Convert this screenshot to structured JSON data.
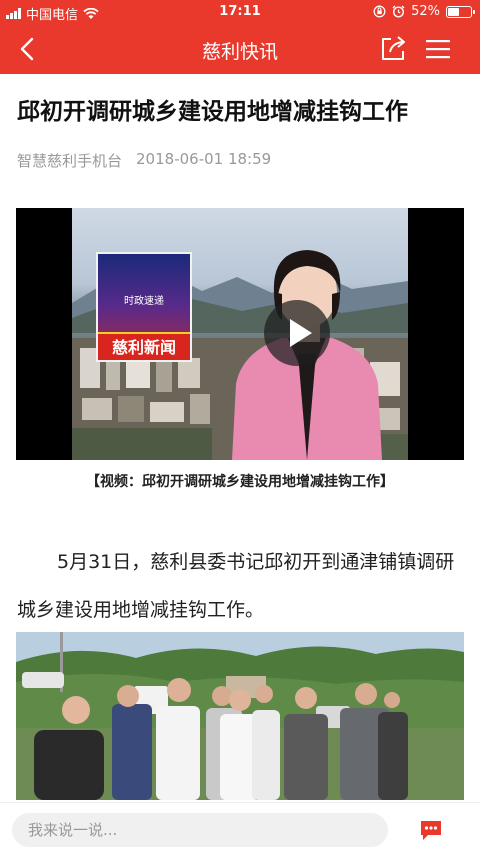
{
  "status_bar": {
    "carrier": "中国电信",
    "time": "17:11",
    "battery_percent": "52%",
    "battery_level": 0.52
  },
  "nav": {
    "title": "慈利快讯",
    "back_icon": "chevron-left-icon",
    "share_icon": "share-icon",
    "menu_icon": "menu-icon"
  },
  "article": {
    "title": "邱初开调研城乡建设用地增减挂钩工作",
    "source": "智慧慈利手机台",
    "datetime": "2018-06-01 18:59",
    "video": {
      "logo_top_text": "时政速递",
      "logo_band_text": "慈利新闻",
      "play_icon": "play-icon"
    },
    "video_caption": "【视频：邱初开调研城乡建设用地增减挂钩工作】",
    "paragraph": "5月31日，慈利县委书记邱初开到通津铺镇调研城乡建设用地增减挂钩工作。"
  },
  "comment_bar": {
    "placeholder": "我来说一说...",
    "comment_icon": "comment-icon"
  },
  "colors": {
    "brand_red": "#e8392c"
  }
}
